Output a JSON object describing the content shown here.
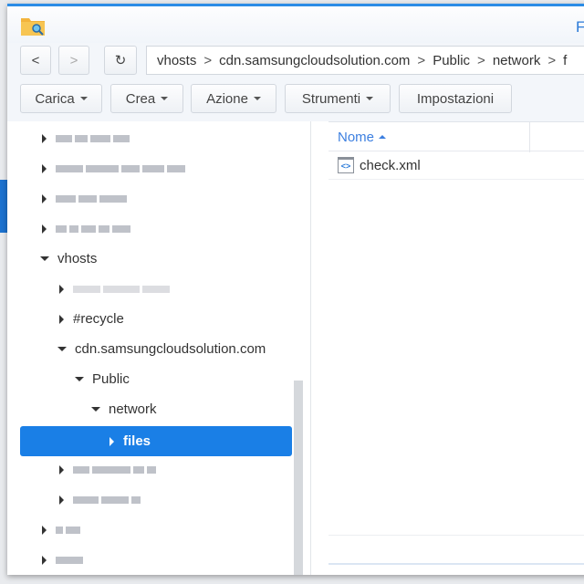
{
  "window": {
    "title": "F"
  },
  "nav": {
    "back": "<",
    "forward": ">",
    "refresh": "C"
  },
  "path": {
    "segments": [
      "vhosts",
      "cdn.samsungcloudsolution.com",
      "Public",
      "network",
      "f"
    ],
    "separator": ">"
  },
  "toolbar": {
    "carica": "Carica",
    "crea": "Crea",
    "azione": "Azione",
    "strumenti": "Strumenti",
    "impostazioni": "Impostazioni"
  },
  "tree": {
    "vhosts": "vhosts",
    "recycle": "#recycle",
    "cdn": "cdn.samsungcloudsolution.com",
    "public": "Public",
    "network": "network",
    "files": "files"
  },
  "list": {
    "column_name": "Nome",
    "sort": "ascending",
    "files": [
      {
        "name": "check.xml",
        "icon": "xml-file-icon"
      }
    ]
  },
  "colors": {
    "accent": "#1a7fe6",
    "header_text": "#3c7fe0"
  }
}
